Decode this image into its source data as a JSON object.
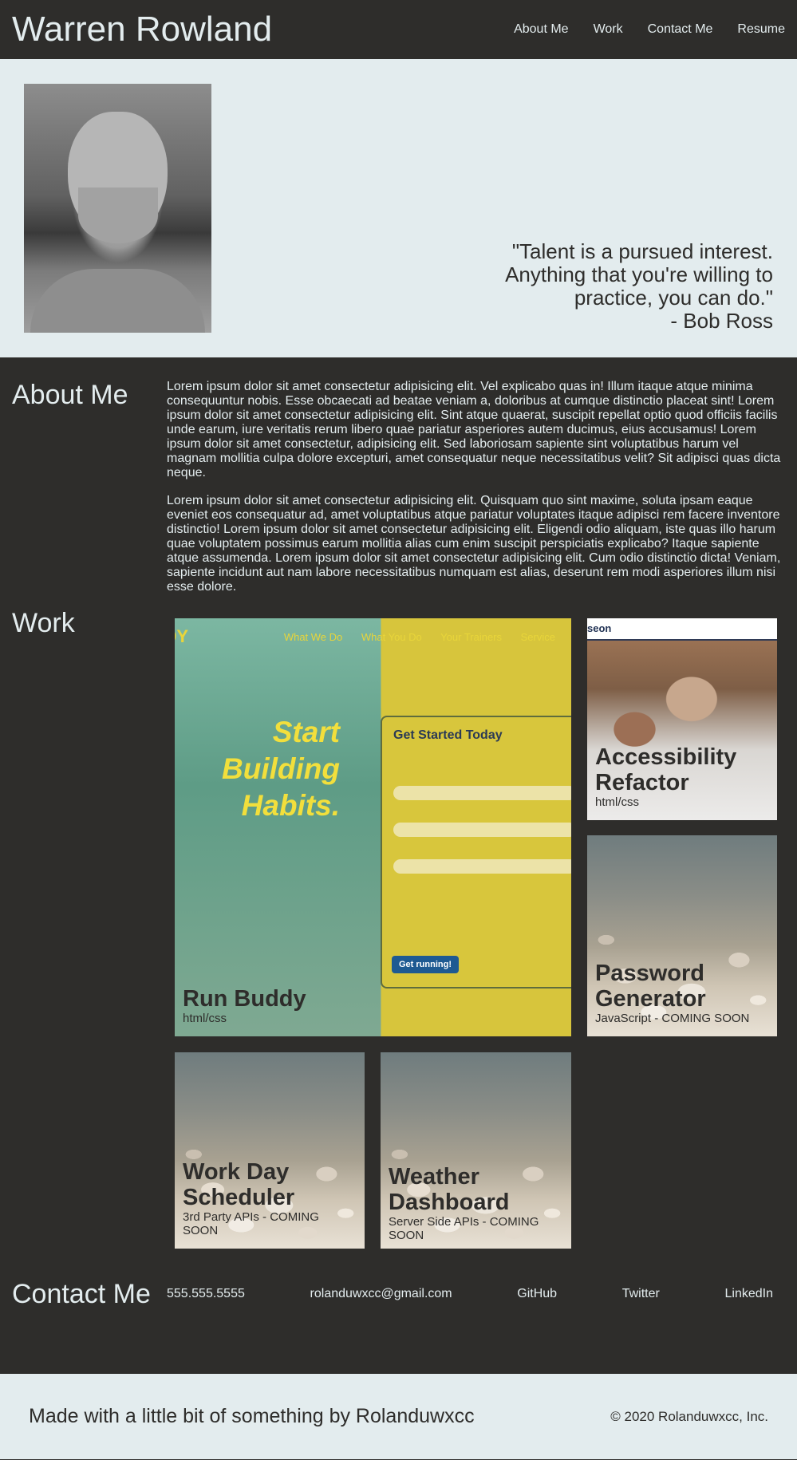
{
  "header": {
    "title": "Warren Rowland",
    "nav": [
      "About Me",
      "Work",
      "Contact Me",
      "Resume"
    ]
  },
  "hero": {
    "quote_lines": [
      "\"Talent is a pursued interest.",
      "Anything that you're willing to",
      "practice, you can do.\"",
      "- Bob Ross"
    ]
  },
  "about": {
    "title": "About Me",
    "paragraphs": [
      "Lorem ipsum dolor sit amet consectetur adipisicing elit. Vel explicabo quas in! Illum itaque atque minima consequuntur nobis. Esse obcaecati ad beatae veniam a, doloribus at cumque distinctio placeat sint! Lorem ipsum dolor sit amet consectetur adipisicing elit. Sint atque quaerat, suscipit repellat optio quod officiis facilis unde earum, iure veritatis rerum libero quae pariatur asperiores autem ducimus, eius accusamus! Lorem ipsum dolor sit amet consectetur, adipisicing elit. Sed laboriosam sapiente sint voluptatibus harum vel magnam mollitia culpa dolore excepturi, amet consequatur neque necessitatibus velit? Sit adipisci quas dicta neque.",
      "Lorem ipsum dolor sit amet consectetur adipisicing elit. Quisquam quo sint maxime, soluta ipsam eaque eveniet eos consequatur ad, amet voluptatibus atque pariatur voluptates itaque adipisci rem facere inventore distinctio! Lorem ipsum dolor sit amet consectetur adipisicing elit. Eligendi odio aliquam, iste quas illo harum quae voluptatem possimus earum mollitia alias cum enim suscipit perspiciatis explicabo? Itaque sapiente atque assumenda. Lorem ipsum dolor sit amet consectetur adipisicing elit. Cum odio distinctio dicta! Veniam, sapiente incidunt aut nam labore necessitatibus numquam est alias, deserunt rem modi asperiores illum nisi esse dolore."
    ]
  },
  "work": {
    "title": "Work",
    "projects": [
      {
        "name": "Run Buddy",
        "tag": "html/css"
      },
      {
        "name": "Accessibility Refactor",
        "tag": "html/css"
      },
      {
        "name": "Password Generator",
        "tag": "JavaScript - COMING SOON"
      },
      {
        "name": "Work Day Scheduler",
        "tag": "3rd Party APIs - COMING SOON"
      },
      {
        "name": "Weather Dashboard",
        "tag": "Server Side APIs - COMING SOON"
      }
    ],
    "runbuddy_shot": {
      "brand": "DY",
      "nav": [
        "What We Do",
        "What You Do",
        "Your Trainers",
        "Service"
      ],
      "slogan": [
        "Start",
        "Building",
        "Habits."
      ],
      "form_title": "Get Started Today",
      "button": "Get running!"
    },
    "office_shot": {
      "brand": "seon"
    }
  },
  "contact": {
    "title": "Contact Me",
    "phone": "555.555.5555",
    "email": "rolanduwxcc@gmail.com",
    "links": [
      "GitHub",
      "Twitter",
      "LinkedIn"
    ]
  },
  "footer": {
    "left": "Made with a little bit of something by Rolanduwxcc",
    "right": "© 2020 Rolanduwxcc, Inc."
  }
}
